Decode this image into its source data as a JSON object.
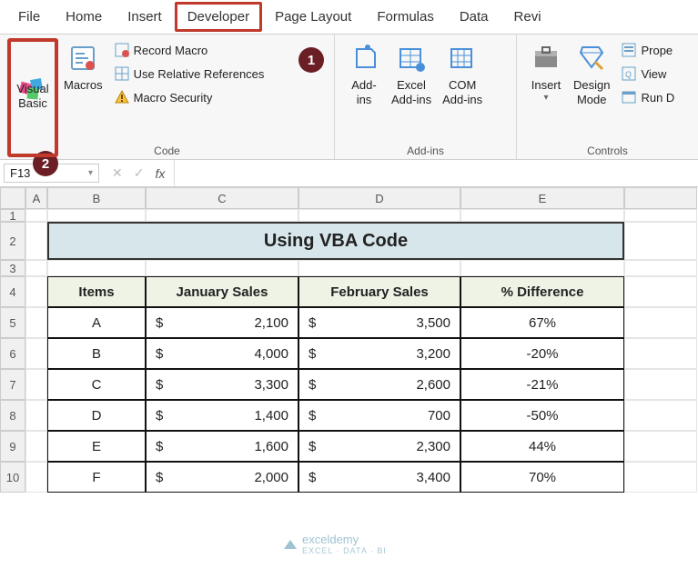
{
  "tabs": {
    "file": "File",
    "home": "Home",
    "insert": "Insert",
    "developer": "Developer",
    "pageLayout": "Page Layout",
    "formulas": "Formulas",
    "data": "Data",
    "review": "Revi"
  },
  "ribbon": {
    "code": {
      "label": "Code",
      "visualBasic": "Visual\nBasic",
      "macros": "Macros",
      "recordMacro": "Record Macro",
      "useRelative": "Use Relative References",
      "macroSecurity": "Macro Security"
    },
    "addins": {
      "label": "Add-ins",
      "addins": "Add-\nins",
      "excelAddins": "Excel\nAdd-ins",
      "comAddins": "COM\nAdd-ins"
    },
    "controls": {
      "label": "Controls",
      "insert": "Insert",
      "designMode": "Design\nMode",
      "properties": "Prope",
      "viewCode": "View",
      "runDialog": "Run D"
    }
  },
  "badges": {
    "b1": "1",
    "b2": "2"
  },
  "namebox": {
    "value": "F13"
  },
  "cols": [
    "A",
    "B",
    "C",
    "D",
    "E"
  ],
  "rownums": [
    "1",
    "2",
    "3",
    "4",
    "5",
    "6",
    "7",
    "8",
    "9",
    "10"
  ],
  "title": "Using VBA Code",
  "headers": {
    "items": "Items",
    "jan": "January Sales",
    "feb": "February Sales",
    "diff": "% Difference"
  },
  "currency": "$",
  "chart_data": {
    "type": "table",
    "title": "Using VBA Code",
    "columns": [
      "Items",
      "January Sales",
      "February Sales",
      "% Difference"
    ],
    "rows": [
      {
        "item": "A",
        "jan": "2,100",
        "feb": "3,500",
        "diff": "67%"
      },
      {
        "item": "B",
        "jan": "4,000",
        "feb": "3,200",
        "diff": "-20%"
      },
      {
        "item": "C",
        "jan": "3,300",
        "feb": "2,600",
        "diff": "-21%"
      },
      {
        "item": "D",
        "jan": "1,400",
        "feb": "700",
        "diff": "-50%"
      },
      {
        "item": "E",
        "jan": "1,600",
        "feb": "2,300",
        "diff": "44%"
      },
      {
        "item": "F",
        "jan": "2,000",
        "feb": "3,400",
        "diff": "70%"
      }
    ]
  },
  "watermark": {
    "brand": "exceldemy",
    "sub": "EXCEL · DATA · BI"
  }
}
